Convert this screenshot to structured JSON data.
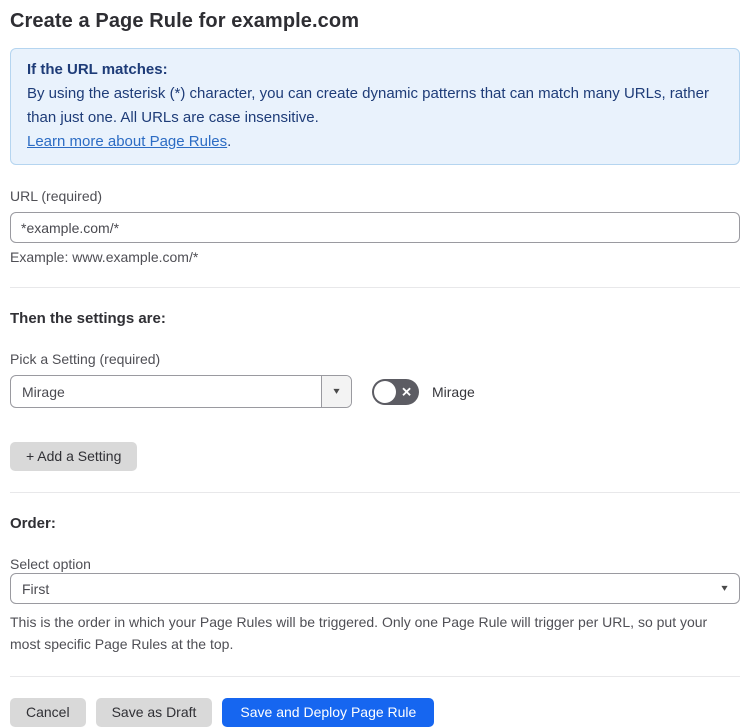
{
  "page": {
    "title": "Create a Page Rule for example.com"
  },
  "info_box": {
    "heading": "If the URL matches:",
    "body": "By using the asterisk (*) character, you can create dynamic patterns that can match many URLs, rather than just one. All URLs are case insensitive.",
    "link_label": "Learn more about Page Rules",
    "link_suffix": "."
  },
  "url_field": {
    "label": "URL (required)",
    "value": "*example.com/*",
    "hint": "Example: www.example.com/*"
  },
  "settings_section": {
    "heading": "Then the settings are:",
    "picker_label": "Pick a Setting (required)",
    "picker_value": "Mirage",
    "toggle_state": "off",
    "toggle_label": "Mirage",
    "add_button_label": "+ Add a Setting"
  },
  "order_section": {
    "heading": "Order:",
    "select_label": "Select option",
    "select_value": "First",
    "help_text": "This is the order in which your Page Rules will be triggered. Only one Page Rule will trigger per URL, so put your most specific Page Rules at the top."
  },
  "actions": {
    "cancel_label": "Cancel",
    "save_draft_label": "Save as Draft",
    "save_deploy_label": "Save and Deploy Page Rule"
  },
  "icons": {
    "caret_down": "▾",
    "x_mark": "✕"
  },
  "colors": {
    "info_background": "#e9f2fc",
    "info_border": "#b5d5f0",
    "info_text": "#1e3c78",
    "link": "#2c6cc4",
    "primary_button": "#1666f0",
    "gray_button": "#d9d9d9",
    "toggle_off": "#5c5c63"
  }
}
